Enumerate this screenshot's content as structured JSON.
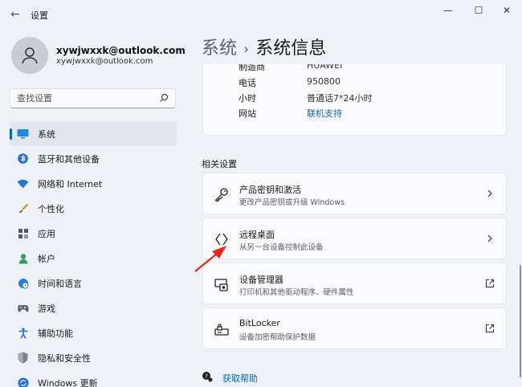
{
  "window": {
    "title": "设置",
    "back_glyph": "←",
    "minimize_glyph": "—",
    "maximize_glyph": "☐",
    "close_glyph": "✕"
  },
  "user": {
    "name": "xywjwxxk@outlook.com",
    "email": "xywjwxxk@outlook.com"
  },
  "search": {
    "placeholder": "查找设置"
  },
  "sidebar": {
    "items": [
      {
        "label": "系统",
        "icon": "monitor-icon",
        "active": true
      },
      {
        "label": "蓝牙和其他设备",
        "icon": "bluetooth-icon"
      },
      {
        "label": "网络和 Internet",
        "icon": "wifi-icon"
      },
      {
        "label": "个性化",
        "icon": "brush-icon"
      },
      {
        "label": "应用",
        "icon": "apps-icon"
      },
      {
        "label": "帐户",
        "icon": "person-icon"
      },
      {
        "label": "时间和语言",
        "icon": "globe-clock-icon"
      },
      {
        "label": "游戏",
        "icon": "game-icon"
      },
      {
        "label": "辅助功能",
        "icon": "accessibility-icon"
      },
      {
        "label": "隐私和安全性",
        "icon": "shield-icon"
      },
      {
        "label": "Windows 更新",
        "icon": "update-icon"
      }
    ]
  },
  "breadcrumb": {
    "parent": "系统",
    "separator": "›",
    "current": "系统信息"
  },
  "support_info": {
    "rows": [
      {
        "key": "制造商",
        "value": "HUAWEI"
      },
      {
        "key": "电话",
        "value": "950800"
      },
      {
        "key": "小时",
        "value": "普通话7*24小时"
      },
      {
        "key": "网站",
        "value": "联机支持"
      }
    ]
  },
  "related": {
    "title": "相关设置",
    "cards": [
      {
        "title": "产品密钥和激活",
        "subtitle": "更改产品密钥或升级 Windows",
        "icon": "key-icon",
        "action": "chevron-right-icon"
      },
      {
        "title": "远程桌面",
        "subtitle": "从另一台设备控制此设备",
        "icon": "remote-desktop-icon",
        "action": "chevron-right-icon"
      },
      {
        "title": "设备管理器",
        "subtitle": "打印机和其他驱动程序、硬件属性",
        "icon": "device-manager-icon",
        "action": "external-link-icon"
      },
      {
        "title": "BitLocker",
        "subtitle": "设备加密帮助保护数据",
        "icon": "bitlocker-icon",
        "action": "external-link-icon"
      }
    ]
  },
  "help": {
    "label": "获取帮助"
  },
  "colors": {
    "accent": "#0067c0",
    "annotation_arrow": "#e8261c",
    "background": "#eef1f6",
    "card": "#fbfbfd"
  }
}
